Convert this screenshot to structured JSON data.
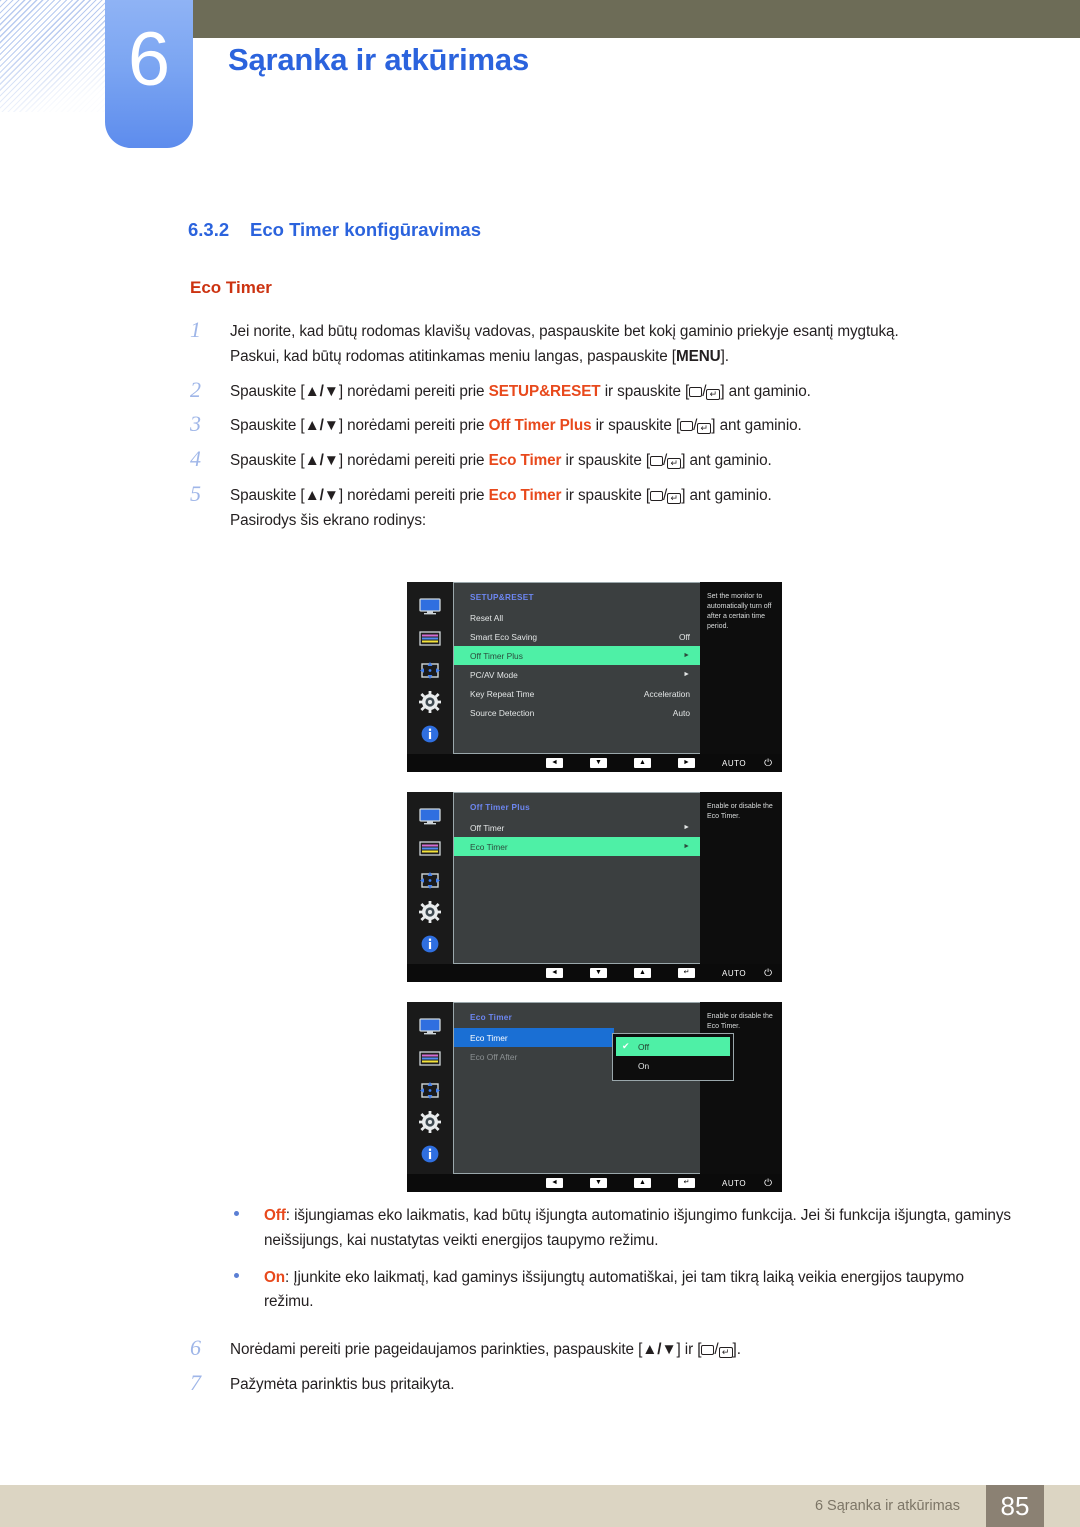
{
  "header": {
    "chapter_number": "6",
    "chapter_title": "Sąranka ir atkūrimas"
  },
  "section": {
    "number": "6.3.2",
    "title": "Eco Timer konfigūravimas",
    "subtitle": "Eco Timer"
  },
  "steps": [
    {
      "n": "1",
      "line1_a": "Jei norite, kad būtų rodomas klavišų vadovas, paspauskite bet kokį gaminio priekyje esantį mygtuką.",
      "line2_a": "Paskui, kad būtų rodomas atitinkamas meniu langas, paspauskite [",
      "line2_key": "MENU",
      "line2_b": "]."
    },
    {
      "n": "2",
      "pre": "Spauskite [",
      "keys": "▲/▼",
      "mid": "] norėdami pereiti prie ",
      "target": "SETUP&RESET",
      "mid2": " ir spauskite [",
      "post": "] ant gaminio."
    },
    {
      "n": "3",
      "pre": "Spauskite [",
      "keys": "▲/▼",
      "mid": "] norėdami pereiti prie ",
      "target": "Off Timer Plus",
      "mid2": " ir spauskite [",
      "post": "] ant gaminio."
    },
    {
      "n": "4",
      "pre": "Spauskite [",
      "keys": "▲/▼",
      "mid": "] norėdami pereiti prie ",
      "target": "Eco Timer",
      "mid2": " ir spauskite [",
      "post": "] ant gaminio."
    },
    {
      "n": "5",
      "pre": "Spauskite [",
      "keys": "▲/▼",
      "mid": "] norėdami pereiti prie ",
      "target": "Eco Timer",
      "mid2": " ir spauskite [",
      "post": "] ant gaminio.",
      "after": "Pasirodys šis ekrano rodinys:"
    }
  ],
  "osd": {
    "rail_icons": [
      "monitor-icon",
      "color-bars-icon",
      "position-arrows-icon",
      "gear-icon",
      "info-icon"
    ],
    "panel1": {
      "title": "SETUP&RESET",
      "rows": [
        {
          "label": "Reset All",
          "value": "",
          "arrow": "",
          "state": "normal"
        },
        {
          "label": "Smart Eco Saving",
          "value": "Off",
          "arrow": "",
          "state": "normal"
        },
        {
          "label": "Off Timer Plus",
          "value": "",
          "arrow": "►",
          "state": "selected"
        },
        {
          "label": "PC/AV Mode",
          "value": "",
          "arrow": "►",
          "state": "normal"
        },
        {
          "label": "Key Repeat Time",
          "value": "Acceleration",
          "arrow": "",
          "state": "normal"
        },
        {
          "label": "Source Detection",
          "value": "Auto",
          "arrow": "",
          "state": "normal"
        }
      ],
      "help": "Set the monitor to automatically turn off after a certain time period.",
      "nav": [
        "◄",
        "▼",
        "▲",
        "►"
      ],
      "auto": "AUTO",
      "power": "⏻"
    },
    "panel2": {
      "title": "Off Timer Plus",
      "rows": [
        {
          "label": "Off Timer",
          "value": "",
          "arrow": "►",
          "state": "normal"
        },
        {
          "label": "Eco Timer",
          "value": "",
          "arrow": "►",
          "state": "selected"
        }
      ],
      "help": "Enable or disable the Eco Timer.",
      "nav": [
        "◄",
        "▼",
        "▲",
        "↵"
      ],
      "auto": "AUTO",
      "power": "⏻"
    },
    "panel3": {
      "title": "Eco Timer",
      "rows": [
        {
          "label": "Eco Timer",
          "value": "",
          "arrow": "",
          "state": "selected-blue"
        },
        {
          "label": "Eco Off After",
          "value": "",
          "arrow": "",
          "state": "dim"
        }
      ],
      "dropdown": [
        {
          "label": "Off",
          "checked": true
        },
        {
          "label": "On",
          "checked": false
        }
      ],
      "help": "Enable or disable the Eco Timer.",
      "nav": [
        "◄",
        "▼",
        "▲",
        "↵"
      ],
      "auto": "AUTO",
      "power": "⏻"
    }
  },
  "bullets": [
    {
      "term": "Off",
      "text": ": išjungiamas eko laikmatis, kad būtų išjungta automatinio išjungimo funkcija. Jei ši funkcija išjungta, gaminys neišsijungs, kai nustatytas veikti energijos taupymo režimu."
    },
    {
      "term": "On",
      "text": ": Įjunkite eko laikmatį, kad gaminys išsijungtų automatiškai, jei tam tikrą laiką veikia energijos taupymo režimu."
    }
  ],
  "steps2": [
    {
      "n": "6",
      "pre": "Norėdami pereiti prie pageidaujamos parinkties, paspauskite [",
      "keys": "▲/▼",
      "mid": "] ir [",
      "post": "]."
    },
    {
      "n": "7",
      "text": "Pažymėta parinktis bus pritaikyta."
    }
  ],
  "footer": {
    "text": "6 Sąranka ir atkūrimas",
    "page": "85"
  },
  "colors": {
    "chapter_blue": "#5d8ced",
    "heading_blue": "#2b63dd",
    "accent_orange": "#e8491c",
    "olive": "#6d6c57",
    "footer_bg": "#dcd5c3",
    "page_box": "#8b8173",
    "osd_highlight": "#4ef0a6",
    "osd_highlight_blue": "#1a6fd4"
  }
}
